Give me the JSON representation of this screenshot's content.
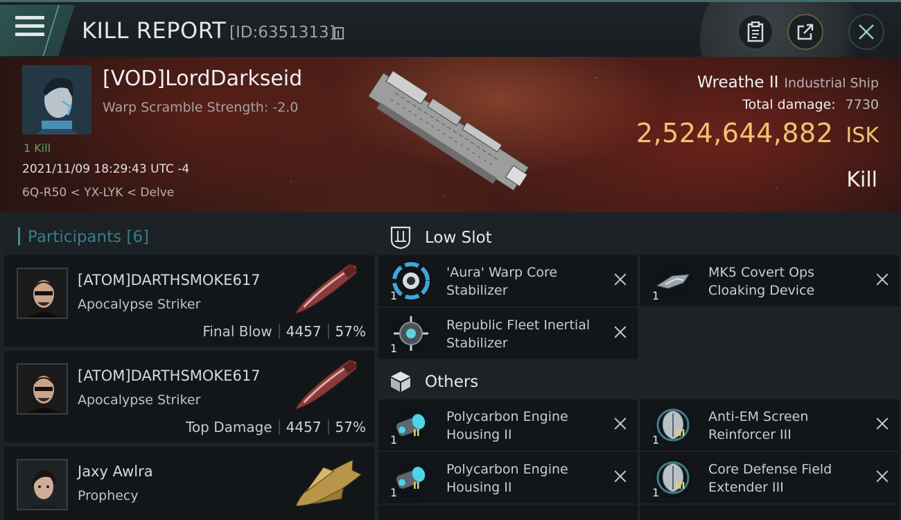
{
  "header": {
    "title": "KILL REPORT",
    "report_id": "[ID:6351313]"
  },
  "victim": {
    "name": "[VOD]LordDarkseid",
    "subtitle": "Warp Scramble Strength: -2.0",
    "kills": "1 Kill",
    "datetime": "2021/11/09 18:29:43 UTC -4",
    "location": "6Q-R50 < YX-LYK < Delve",
    "ship_name": "Wreathe II",
    "ship_class": "Industrial Ship",
    "total_damage_label": "Total damage:",
    "total_damage": "7730",
    "isk_value": "2,524,644,882",
    "isk_unit": "ISK",
    "report_type": "Kill"
  },
  "participants": {
    "label": "Participants",
    "count": "[6]",
    "rows": [
      {
        "name": "[ATOM]DARTHSMOKE617",
        "ship": "Apocalypse Striker",
        "tag": "Final Blow",
        "damage": "4457",
        "percent": "57%"
      },
      {
        "name": "[ATOM]DARTHSMOKE617",
        "ship": "Apocalypse Striker",
        "tag": "Top Damage",
        "damage": "4457",
        "percent": "57%"
      },
      {
        "name": "Jaxy Awlra",
        "ship": "Prophecy"
      }
    ]
  },
  "low_slot": {
    "title": "Low Slot",
    "items": [
      {
        "label": "'Aura' Warp Core Stabilizer",
        "qty": "1"
      },
      {
        "label": "MK5 Covert Ops Cloaking Device",
        "qty": "1"
      },
      {
        "label": "Republic Fleet Inertial Stabilizer",
        "qty": "1"
      }
    ]
  },
  "others": {
    "title": "Others",
    "items": [
      {
        "label": "Polycarbon Engine Housing II",
        "qty": "1",
        "tier": "II"
      },
      {
        "label": "Anti-EM Screen Reinforcer III",
        "qty": "1",
        "tier": "III"
      },
      {
        "label": "Polycarbon Engine Housing II",
        "qty": "1",
        "tier": "II"
      },
      {
        "label": "Core Defense Field Extender III",
        "qty": "1",
        "tier": "III"
      }
    ]
  },
  "colors": {
    "accent_teal": "#3a7e87",
    "isk_gold": "#f0c472",
    "kill_green": "#5fa860"
  }
}
